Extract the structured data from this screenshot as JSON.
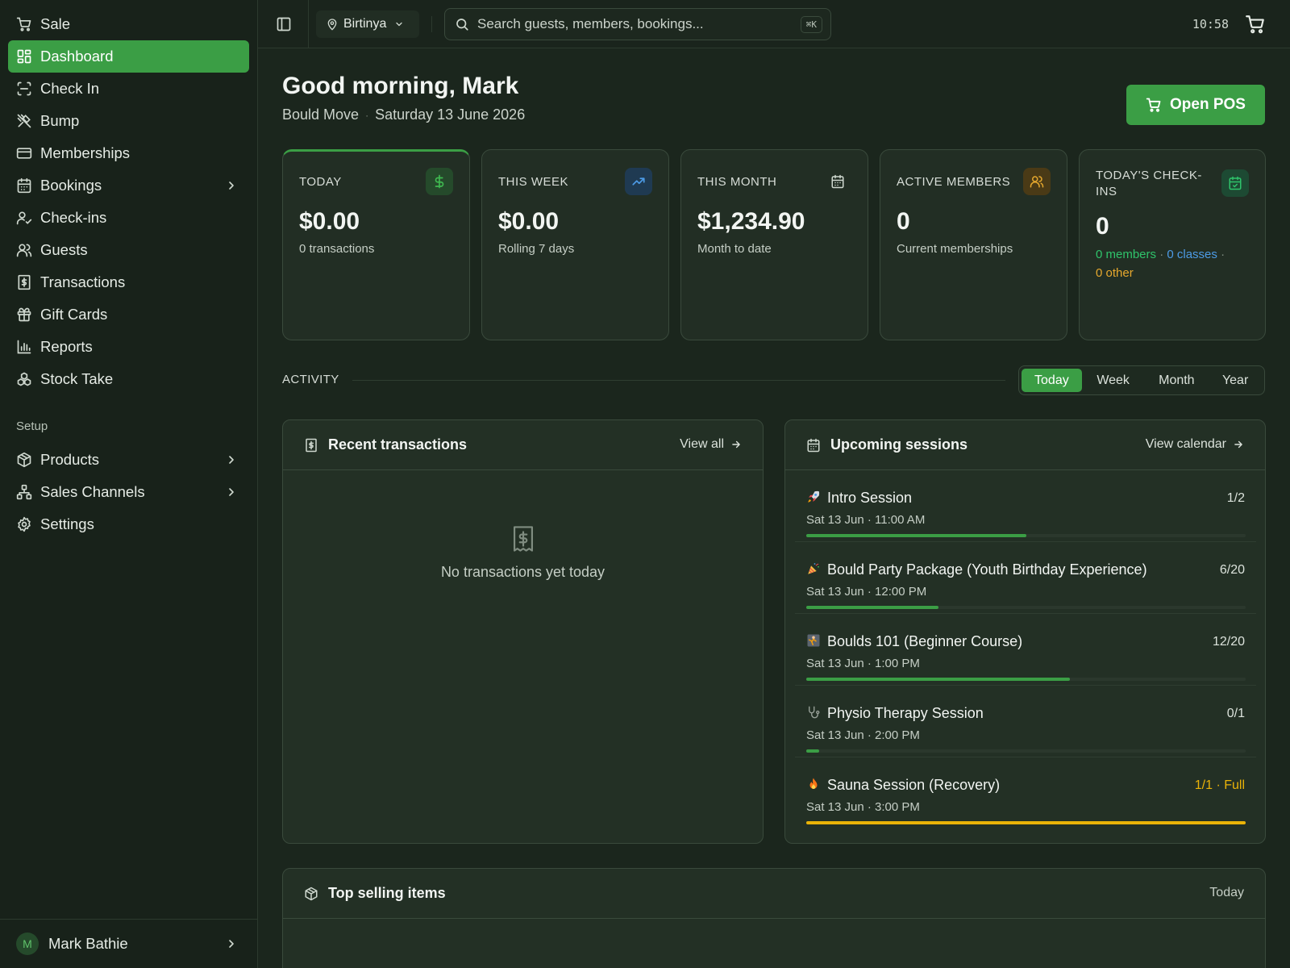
{
  "sidebar": {
    "items": [
      {
        "label": "Sale",
        "icon": "cart-icon"
      },
      {
        "label": "Dashboard",
        "icon": "dashboard-icon",
        "active": true
      },
      {
        "label": "Check In",
        "icon": "scan-icon"
      },
      {
        "label": "Bump",
        "icon": "utensils-icon"
      },
      {
        "label": "Memberships",
        "icon": "card-icon"
      },
      {
        "label": "Bookings",
        "icon": "calendar-icon",
        "expandable": true
      },
      {
        "label": "Check-ins",
        "icon": "user-check-icon"
      },
      {
        "label": "Guests",
        "icon": "users-icon"
      },
      {
        "label": "Transactions",
        "icon": "receipt-icon"
      },
      {
        "label": "Gift Cards",
        "icon": "gift-icon"
      },
      {
        "label": "Reports",
        "icon": "bar-chart-icon"
      },
      {
        "label": "Stock Take",
        "icon": "boxes-icon"
      }
    ],
    "setup_label": "Setup",
    "setup_items": [
      {
        "label": "Products",
        "icon": "package-icon",
        "expandable": true
      },
      {
        "label": "Sales Channels",
        "icon": "network-icon",
        "expandable": true
      },
      {
        "label": "Settings",
        "icon": "gear-icon"
      }
    ],
    "user": {
      "initial": "M",
      "name": "Mark Bathie"
    }
  },
  "topbar": {
    "location": "Birtinya",
    "search_placeholder": "Search guests, members, bookings...",
    "search_shortcut": "⌘K",
    "time": "10:58"
  },
  "header": {
    "greeting": "Good morning, Mark",
    "business": "Bould Move",
    "date": "Saturday 13 June 2026",
    "open_pos_label": "Open POS"
  },
  "stats": [
    {
      "label": "TODAY",
      "value": "$0.00",
      "sub": "0 transactions",
      "icon": "dollar-icon",
      "color": "#3b9e45"
    },
    {
      "label": "THIS WEEK",
      "value": "$0.00",
      "sub": "Rolling 7 days",
      "icon": "trending-up-icon",
      "color": "#4d9be6"
    },
    {
      "label": "THIS MONTH",
      "value": "$1,234.90",
      "sub": "Month to date",
      "icon": "calendar-icon",
      "color": "#cfd8cf"
    },
    {
      "label": "ACTIVE MEMBERS",
      "value": "0",
      "sub": "Current memberships",
      "icon": "users-icon",
      "color": "#e6a82e"
    },
    {
      "label": "TODAY'S CHECK-INS",
      "value": "0",
      "members": "0 members",
      "classes": "0 classes",
      "other": "0 other",
      "icon": "calendar-check-icon",
      "color": "#2fc36b"
    }
  ],
  "activity": {
    "label": "ACTIVITY",
    "ranges": [
      "Today",
      "Week",
      "Month",
      "Year"
    ],
    "selected": "Today"
  },
  "recent_transactions": {
    "title": "Recent transactions",
    "link": "View all",
    "empty": "No transactions yet today"
  },
  "upcoming_sessions": {
    "title": "Upcoming sessions",
    "link": "View calendar",
    "sessions": [
      {
        "emoji": "🚀",
        "name": "Intro Session",
        "time": "Sat 13 Jun · 11:00 AM",
        "capacity": "1/2",
        "fill": 0.5
      },
      {
        "emoji": "🎉",
        "name": "Bould Party Package (Youth Birthday Experience)",
        "time": "Sat 13 Jun · 12:00 PM",
        "capacity": "6/20",
        "fill": 0.3
      },
      {
        "emoji": "🧗",
        "name": "Boulds 101 (Beginner Course)",
        "time": "Sat 13 Jun · 1:00 PM",
        "capacity": "12/20",
        "fill": 0.6
      },
      {
        "emoji": "🩺",
        "name": "Physio Therapy Session",
        "time": "Sat 13 Jun · 2:00 PM",
        "capacity": "0/1",
        "fill": 0.03
      },
      {
        "emoji": "🔥",
        "name": "Sauna Session (Recovery)",
        "time": "Sat 13 Jun · 3:00 PM",
        "capacity": "1/1 · Full",
        "fill": 1.0,
        "full": true
      }
    ]
  },
  "top_selling": {
    "title": "Top selling items",
    "range": "Today"
  }
}
